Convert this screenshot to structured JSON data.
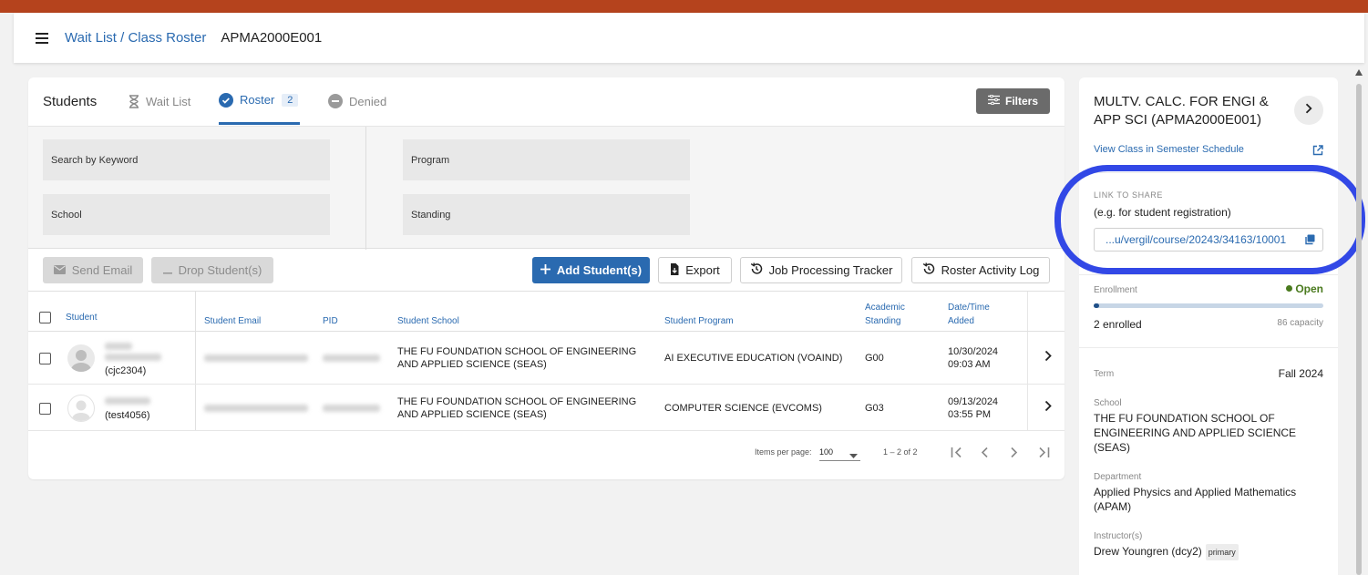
{
  "header": {
    "breadcrumb": "Wait List / Class Roster",
    "course_code": "APMA2000E001"
  },
  "tabs": {
    "title": "Students",
    "wait_list": "Wait List",
    "roster": "Roster",
    "roster_count": "2",
    "denied": "Denied",
    "filters": "Filters"
  },
  "filters": {
    "keyword": "Search by Keyword",
    "school": "School",
    "program": "Program",
    "standing": "Standing"
  },
  "actions": {
    "send_email": "Send Email",
    "drop": "Drop Student(s)",
    "add": "Add Student(s)",
    "export": "Export",
    "job_tracker": "Job Processing Tracker",
    "activity_log": "Roster Activity Log"
  },
  "table": {
    "headers": {
      "student": "Student",
      "email": "Student Email",
      "pid": "PID",
      "school": "Student School",
      "program": "Student Program",
      "standing": "Academic Standing",
      "date": "Date/Time Added"
    },
    "rows": [
      {
        "uni": "(cjc2304)",
        "school": "THE FU FOUNDATION SCHOOL OF ENGINEERING AND APPLIED SCIENCE (SEAS)",
        "program": "AI EXECUTIVE EDUCATION (VOAIND)",
        "standing": "G00",
        "date": "10/30/2024",
        "time": "09:03 AM"
      },
      {
        "uni": "(test4056)",
        "school": "THE FU FOUNDATION SCHOOL OF ENGINEERING AND APPLIED SCIENCE (SEAS)",
        "program": "COMPUTER SCIENCE (EVCOMS)",
        "standing": "G03",
        "date": "09/13/2024",
        "time": "03:55 PM"
      }
    ]
  },
  "pager": {
    "items_label": "Items per page:",
    "per_page": "100",
    "range": "1 – 2 of 2"
  },
  "side": {
    "title": "MULTV. CALC. FOR ENGI & APP SCI (APMA2000E001)",
    "view_link": "View Class in Semester Schedule",
    "share_label": "LINK TO SHARE",
    "share_hint": "(e.g. for student registration)",
    "share_url": "...u/vergil/course/20243/34163/10001",
    "enrollment_label": "Enrollment",
    "status": "Open",
    "enrolled": "2 enrolled",
    "capacity": "86 capacity",
    "enrollment_fraction": 0.023,
    "term_label": "Term",
    "term": "Fall 2024",
    "school_label": "School",
    "school": "THE FU FOUNDATION SCHOOL OF ENGINEERING AND APPLIED SCIENCE (SEAS)",
    "dept_label": "Department",
    "dept": "Applied Physics and Applied Mathematics (APAM)",
    "instructor_label": "Instructor(s)",
    "instructor": "Drew Youngren (dcy2)",
    "instructor_tag": "primary"
  },
  "colors": {
    "brand_strip": "#b5431d",
    "accent": "#2a6ab0",
    "annotation": "#3248e6",
    "open": "#4a7a1e"
  },
  "icons": [
    "menu-icon",
    "hourglass-icon",
    "check-circle-icon",
    "minus-circle-icon",
    "sliders-icon",
    "mail-icon",
    "minus-icon",
    "plus-icon",
    "export-file-icon",
    "history-icon",
    "chevron-right-icon",
    "external-link-icon",
    "copy-icon",
    "first-page-icon",
    "prev-page-icon",
    "next-page-icon",
    "last-page-icon",
    "dropdown-icon"
  ]
}
